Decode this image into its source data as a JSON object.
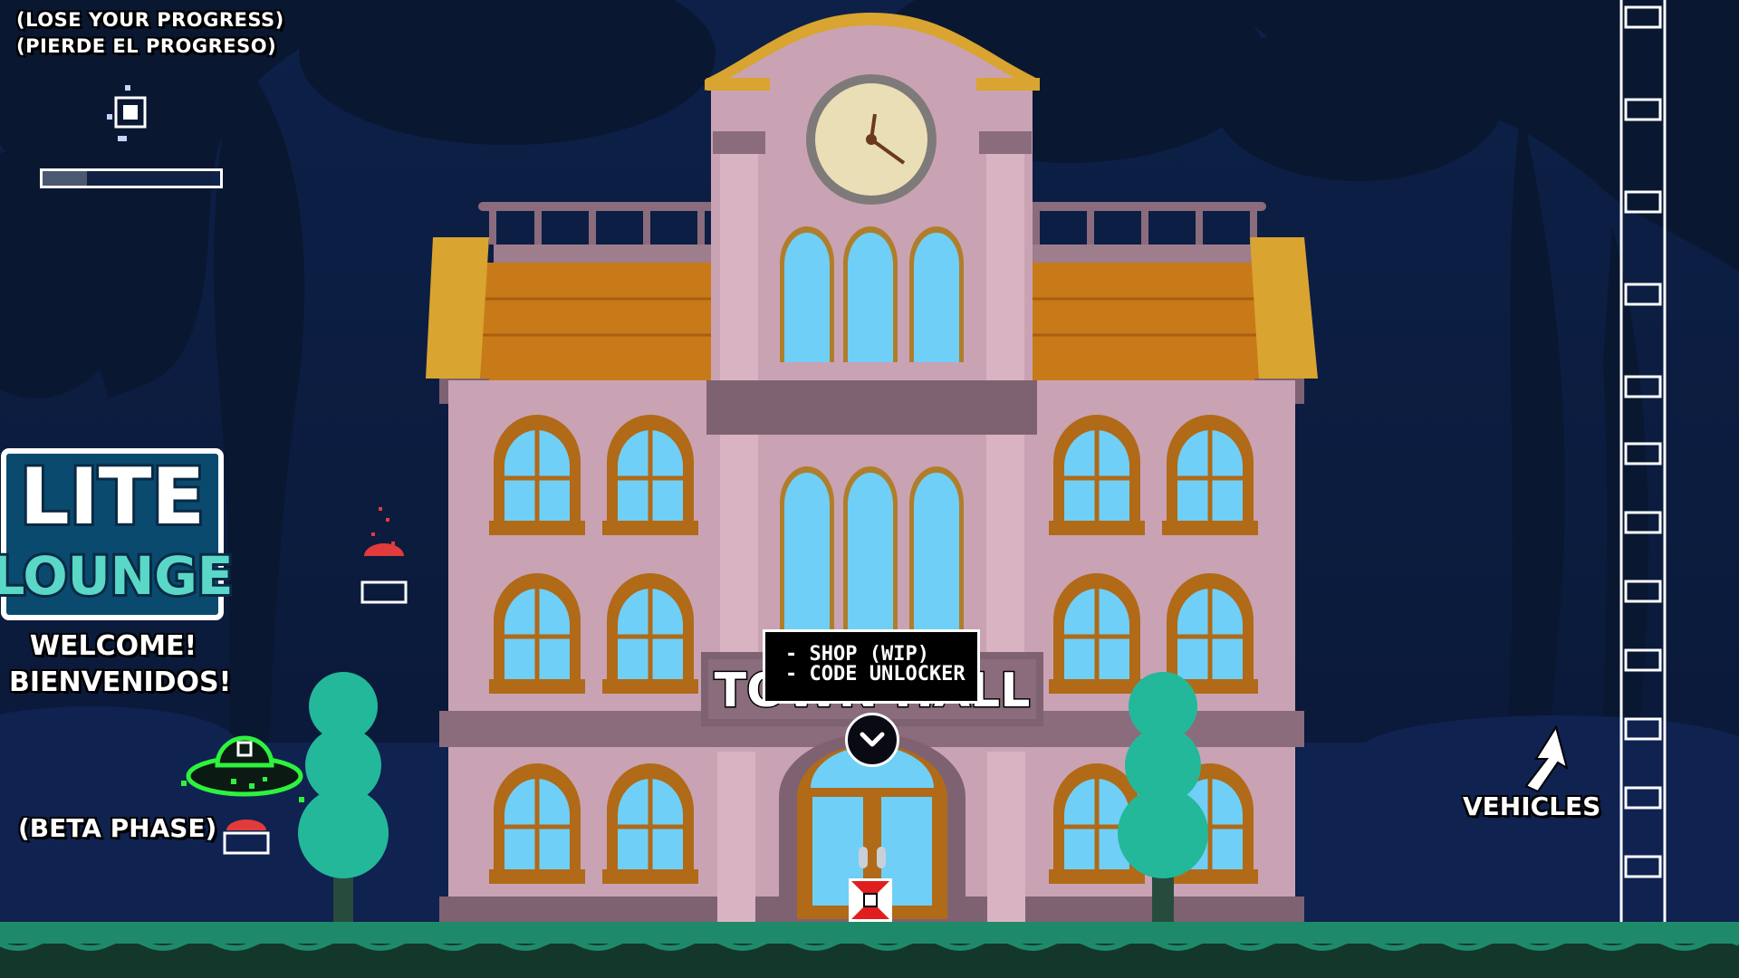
{
  "warning": {
    "line1": "(LOSE YOUR PROGRESS)",
    "line2": "(PIERDE EL PROGRESO)"
  },
  "logo": {
    "line1": "LITE",
    "line2": "LOUNGE"
  },
  "welcome": {
    "line1": "WELCOME!",
    "line2": "BIENVENIDOS!"
  },
  "beta_label": "(BETA PHASE)",
  "vehicles_label": "VEHICLES",
  "building": {
    "sign": "TOWN HALL"
  },
  "tooltip": {
    "line1": "- SHOP (WIP)",
    "line2": "- CODE UNLOCKER"
  },
  "progress": 0.25,
  "colors": {
    "sky": "#0c1c3e",
    "building_wall": "#c9a3b3",
    "roof": "#c97a18",
    "window": "#6fcff7",
    "ground": "#1f8a6a",
    "tree": "#23b89a",
    "accent_green": "#2ef23e"
  },
  "icons": {
    "enter": "chevron-down-icon",
    "reset": "reset-icon",
    "arrow": "arrow-up-icon",
    "ufo": "ufo-icon",
    "player": "player-icon"
  }
}
